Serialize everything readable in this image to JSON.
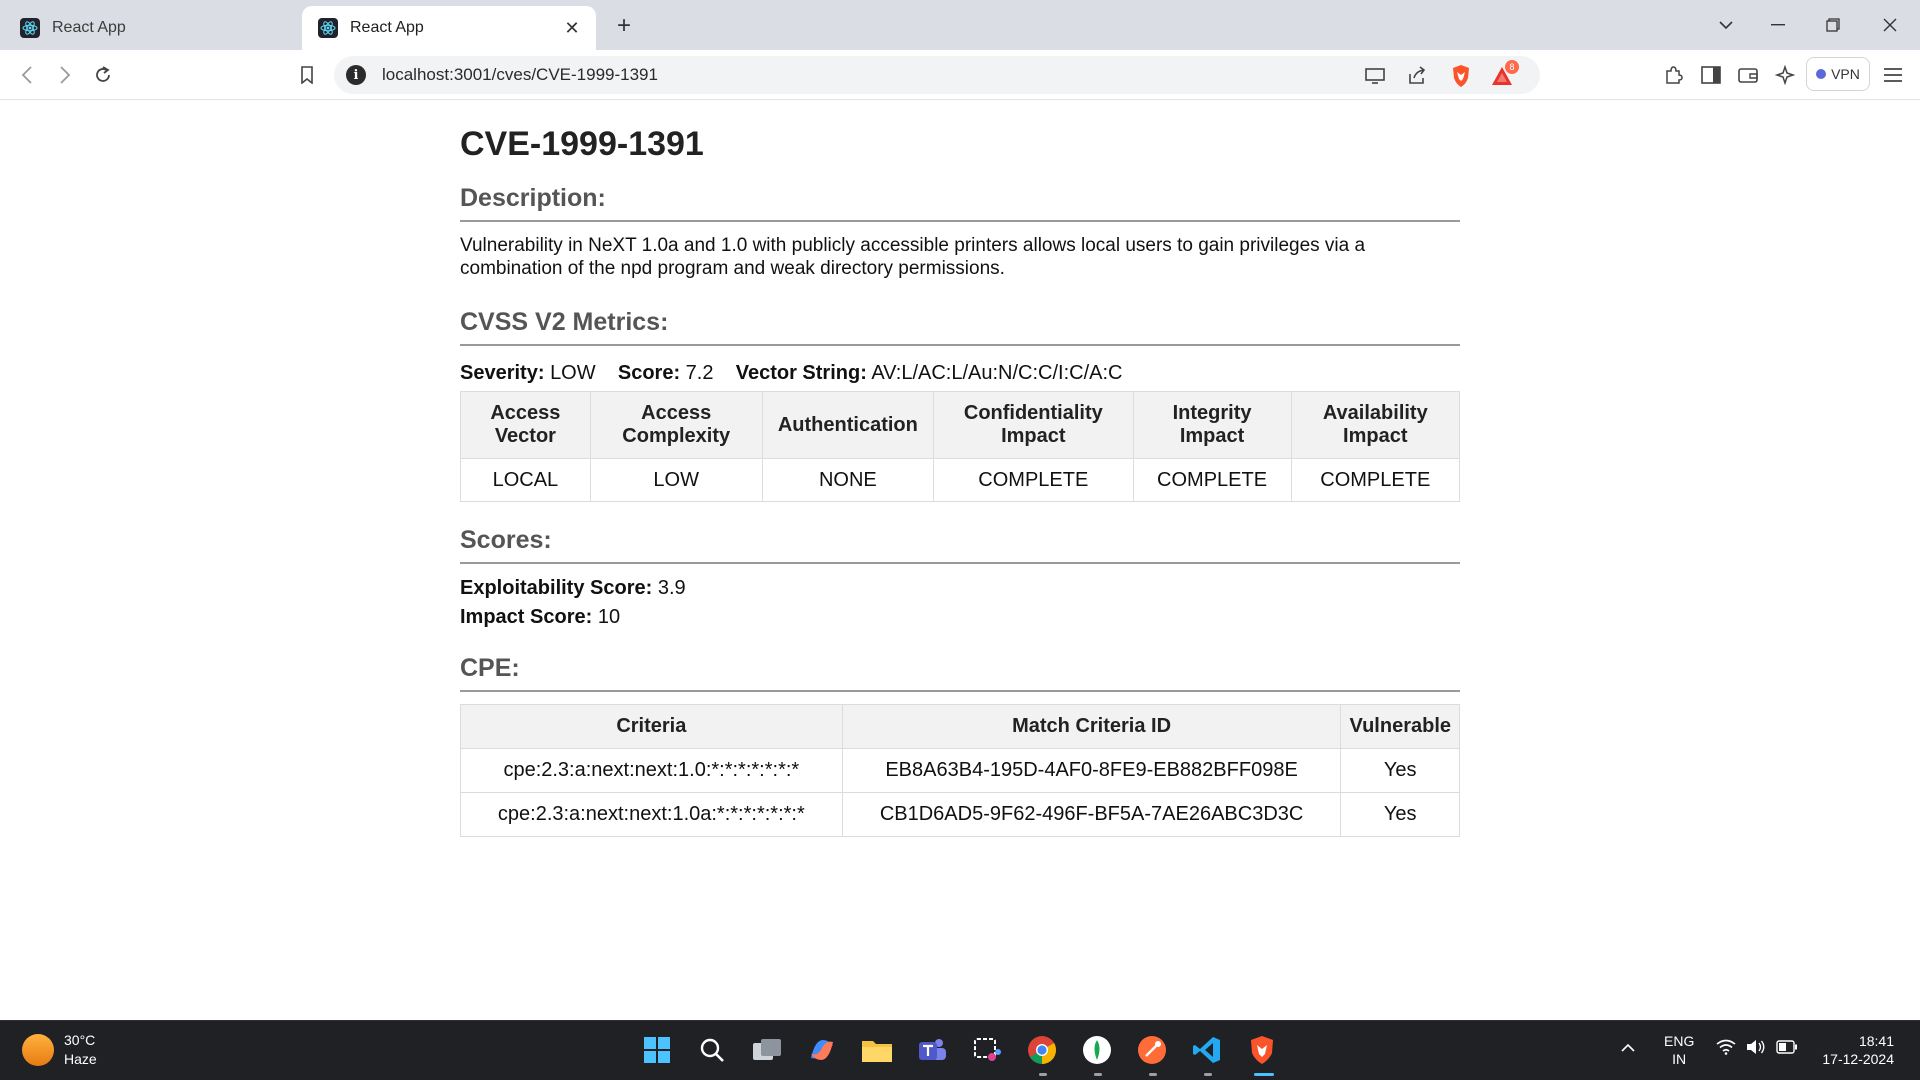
{
  "browser": {
    "tabs": [
      {
        "title": "React App",
        "active": false
      },
      {
        "title": "React App",
        "active": true
      }
    ],
    "url": "localhost:3001/cves/CVE-1999-1391",
    "vpn_label": "VPN",
    "notification_count": "8"
  },
  "cve": {
    "id": "CVE-1999-1391",
    "description_heading": "Description:",
    "description": "Vulnerability in NeXT 1.0a and 1.0 with publicly accessible printers allows local users to gain privileges via a combination of the npd program and weak directory permissions.",
    "cvss_heading": "CVSS V2 Metrics:",
    "severity_label": "Severity:",
    "severity": "LOW",
    "score_label": "Score:",
    "score": "7.2",
    "vector_label": "Vector String:",
    "vector": "AV:L/AC:L/Au:N/C:C/I:C/A:C",
    "metrics_headers": [
      "Access Vector",
      "Access Complexity",
      "Authentication",
      "Confidentiality Impact",
      "Integrity Impact",
      "Availability Impact"
    ],
    "metrics_values": [
      "LOCAL",
      "LOW",
      "NONE",
      "COMPLETE",
      "COMPLETE",
      "COMPLETE"
    ],
    "scores_heading": "Scores:",
    "exploitability_label": "Exploitability Score:",
    "exploitability": "3.9",
    "impact_label": "Impact Score:",
    "impact": "10",
    "cpe_heading": "CPE:",
    "cpe_headers": [
      "Criteria",
      "Match Criteria ID",
      "Vulnerable"
    ],
    "cpe_rows": [
      [
        "cpe:2.3:a:next:next:1.0:*:*:*:*:*:*:*",
        "EB8A63B4-195D-4AF0-8FE9-EB882BFF098E",
        "Yes"
      ],
      [
        "cpe:2.3:a:next:next:1.0a:*:*:*:*:*:*:*",
        "CB1D6AD5-9F62-496F-BF5A-7AE26ABC3D3C",
        "Yes"
      ]
    ]
  },
  "taskbar": {
    "temperature": "30°C",
    "weather": "Haze",
    "language": "ENG",
    "region": "IN",
    "time": "18:41",
    "date": "17-12-2024"
  },
  "colors": {
    "accent_brave": "#fb542b",
    "taskbar_bg": "#1f2125",
    "heading_grey": "#555555"
  }
}
